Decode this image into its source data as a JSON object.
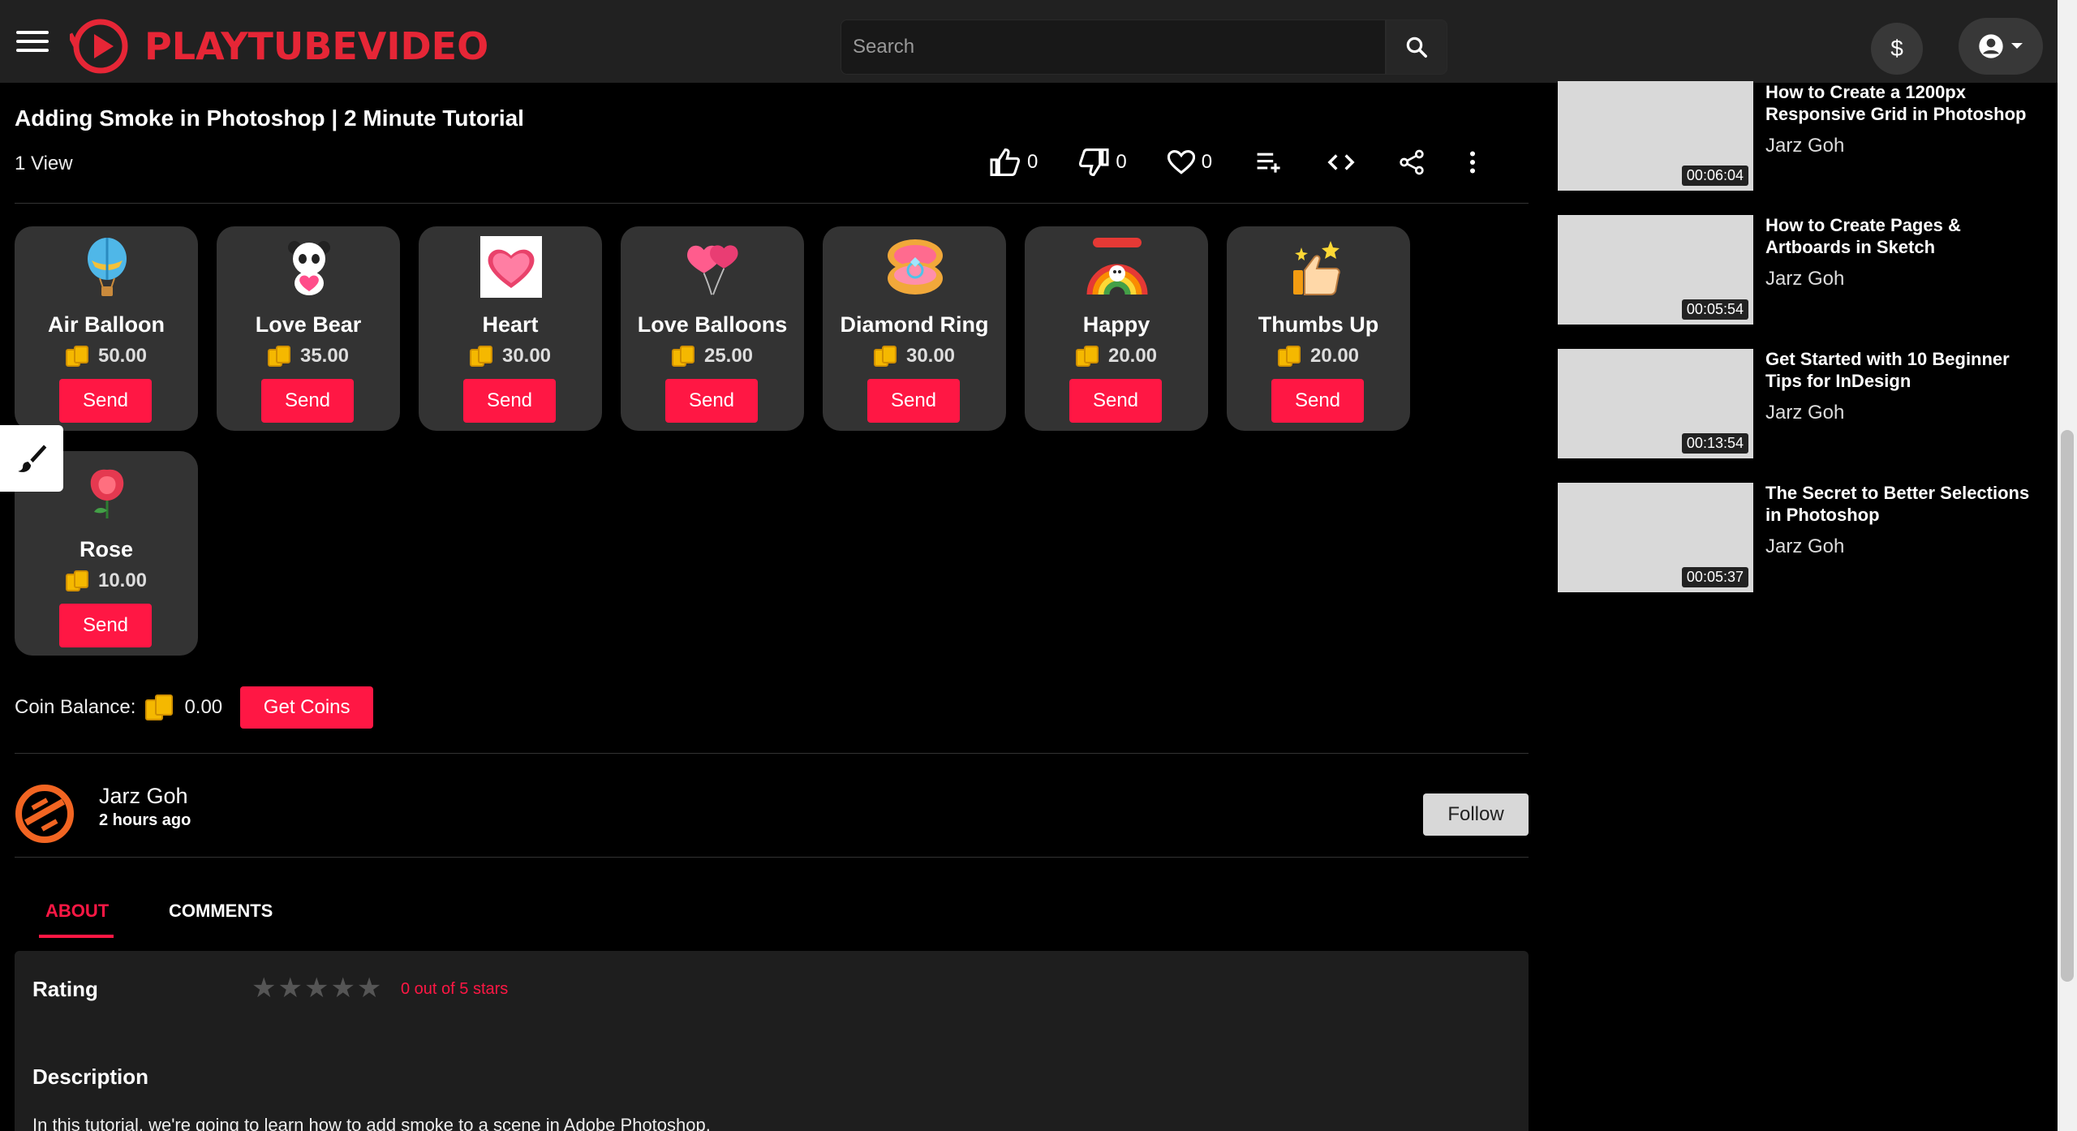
{
  "header": {
    "brand": "PLAYTUBEVIDEO",
    "search_placeholder": "Search",
    "wallet_symbol": "$"
  },
  "video": {
    "title": "Adding Smoke in Photoshop | 2 Minute Tutorial",
    "views": "1 View",
    "likes": "0",
    "dislikes": "0",
    "favorites": "0"
  },
  "gifts": [
    {
      "name": "Air Balloon",
      "price": "50.00",
      "icon": "hot-air-balloon-icon",
      "send": "Send"
    },
    {
      "name": "Love Bear",
      "price": "35.00",
      "icon": "panda-heart-icon",
      "send": "Send"
    },
    {
      "name": "Heart",
      "price": "30.00",
      "icon": "heart-icon",
      "send": "Send"
    },
    {
      "name": "Love Balloons",
      "price": "25.00",
      "icon": "heart-balloons-icon",
      "send": "Send"
    },
    {
      "name": "Diamond Ring",
      "price": "30.00",
      "icon": "diamond-ring-icon",
      "send": "Send"
    },
    {
      "name": "Happy",
      "price": "20.00",
      "icon": "rainbow-icon",
      "send": "Send"
    },
    {
      "name": "Thumbs Up",
      "price": "20.00",
      "icon": "thumbs-up-icon",
      "send": "Send"
    },
    {
      "name": "Rose",
      "price": "10.00",
      "icon": "rose-icon",
      "send": "Send"
    }
  ],
  "balance": {
    "label": "Coin Balance:",
    "value": "0.00",
    "get_coins": "Get Coins"
  },
  "channel": {
    "name": "Jarz Goh",
    "time": "2 hours ago",
    "follow": "Follow"
  },
  "tabs": {
    "about": "ABOUT",
    "comments": "COMMENTS"
  },
  "about": {
    "rating_label": "Rating",
    "stars": "★★★★★",
    "rating_text": "0 out of 5 stars",
    "description_label": "Description",
    "description": "In this tutorial, we're going to learn how to add smoke to a scene in Adobe Photoshop."
  },
  "related": [
    {
      "title": "How to Create a 1200px Responsive Grid in Photoshop",
      "channel": "Jarz Goh",
      "duration": "00:06:04"
    },
    {
      "title": "How to Create Pages & Artboards in Sketch",
      "channel": "Jarz Goh",
      "duration": "00:05:54"
    },
    {
      "title": "Get Started with 10 Beginner Tips for InDesign",
      "channel": "Jarz Goh",
      "duration": "00:13:54"
    },
    {
      "title": "The Secret to Better Selections in Photoshop",
      "channel": "Jarz Goh",
      "duration": "00:05:37"
    }
  ],
  "colors": {
    "accent": "#ff1744",
    "brand": "#e62636",
    "card": "#333333",
    "topbar": "#212121"
  }
}
